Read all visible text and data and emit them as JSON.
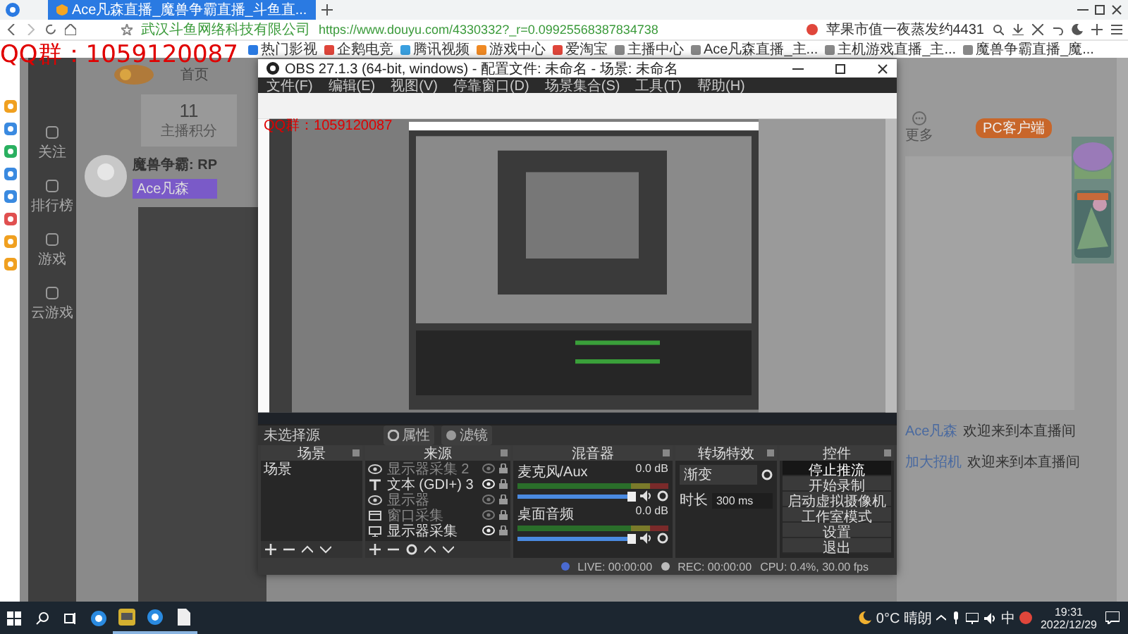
{
  "browser": {
    "tabs": [
      {
        "title": "Ace凡森直播_魔兽争霸直播_斗鱼直...",
        "selected": true
      }
    ],
    "url": "https://www.douyu.com/4330332?_r=0.09925568387834738",
    "site_owner": "武汉斗鱼网络科技有限公司",
    "news": "苹果市值一夜蒸发约4431",
    "bookmarks": [
      "热门影视",
      "企鹅电竞",
      "腾讯视频",
      "游戏中心",
      "爱淘宝",
      "主播中心",
      "Ace凡森直播_主...",
      "主机游戏直播_主...",
      "魔兽争霸直播_魔..."
    ]
  },
  "overlay": {
    "text": "QQ群：1059120087"
  },
  "page": {
    "nav": [
      "关注",
      "排行榜",
      "游戏",
      "云游戏"
    ],
    "home": "首页",
    "score": "11",
    "score_label": "主播积分",
    "room_title": "魔兽争霸: RP",
    "streamer": "Ace凡森",
    "more": "更多",
    "client_button": "PC客户端",
    "chat": [
      {
        "user": "Ace凡森",
        "text": "欢迎来到本直播间"
      },
      {
        "user": "加大招机",
        "text": "欢迎来到本直播间"
      }
    ]
  },
  "obs": {
    "title": "OBS 27.1.3 (64-bit, windows) - 配置文件: 未命名 - 场景: 未命名",
    "menu": [
      "文件(F)",
      "编辑(E)",
      "视图(V)",
      "停靠窗口(D)",
      "场景集合(S)",
      "工具(T)",
      "帮助(H)"
    ],
    "preview_overlay": "QQ群：1059120087",
    "source_bar": {
      "label": "未选择源",
      "buttons": [
        "属性",
        "滤镜"
      ]
    },
    "scenes": {
      "title": "场景",
      "items": [
        {
          "label": "场景",
          "selected": false
        }
      ]
    },
    "sources": {
      "title": "来源",
      "items": [
        {
          "label": "显示器采集 2",
          "kind": "display",
          "visible": false
        },
        {
          "label": "文本 (GDI+) 3",
          "kind": "text",
          "visible": true
        },
        {
          "label": "显示器",
          "kind": "display",
          "visible": false
        },
        {
          "label": "窗口采集",
          "kind": "window",
          "visible": false
        },
        {
          "label": "显示器采集",
          "kind": "monitor",
          "visible": true
        }
      ]
    },
    "mixer": {
      "title": "混音器",
      "channels": [
        {
          "name": "麦克风/Aux",
          "reading": "0.0 dB",
          "level": 0.97
        },
        {
          "name": "桌面音频",
          "reading": "0.0 dB",
          "level": 0.97
        }
      ]
    },
    "transitions": {
      "title": "转场特效",
      "type": "渐变",
      "duration_label": "时长",
      "duration": "300 ms"
    },
    "controls": {
      "title": "控件",
      "buttons": [
        {
          "label": "停止推流",
          "active": true
        },
        {
          "label": "开始录制",
          "active": false
        },
        {
          "label": "启动虚拟摄像机",
          "active": false
        },
        {
          "label": "工作室模式",
          "active": false
        },
        {
          "label": "设置",
          "active": false
        },
        {
          "label": "退出",
          "active": false
        }
      ]
    },
    "status": {
      "live": "LIVE: 00:00:00",
      "rec": "REC: 00:00:00",
      "cpu": "CPU: 0.4%, 30.00 fps"
    }
  },
  "taskbar": {
    "apps": [
      {
        "kind": "browser",
        "running": false
      },
      {
        "kind": "chat",
        "running": true
      },
      {
        "kind": "browser",
        "running": true
      },
      {
        "kind": "file",
        "running": true
      }
    ],
    "weather": "0°C 晴朗",
    "ime": "中",
    "time": "19:31",
    "date": "2022/12/29"
  }
}
